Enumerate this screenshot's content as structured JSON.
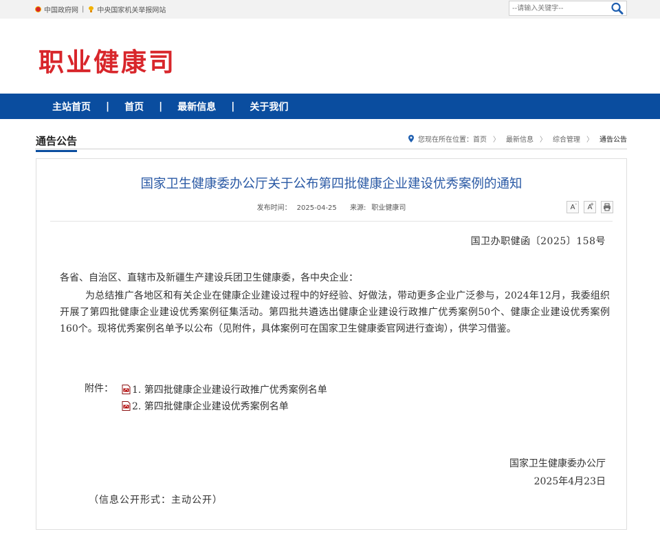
{
  "topbar": {
    "link1": "中国政府网",
    "separator": "|",
    "link2": "中央国家机关举报网站",
    "search_placeholder": "--请输入关键字--"
  },
  "header": {
    "site_title": "职业健康司"
  },
  "nav": {
    "items": [
      "主站首页",
      "首页",
      "最新信息",
      "关于我们"
    ],
    "separator": "|"
  },
  "section": {
    "title": "通告公告",
    "breadcrumb_prefix": "您现在所在位置：",
    "breadcrumb": [
      "首页",
      "最新信息",
      "综合管理",
      "通告公告"
    ],
    "breadcrumb_sep": "〉"
  },
  "article": {
    "title": "国家卫生健康委办公厅关于公布第四批健康企业建设优秀案例的通知",
    "publish_label": "发布时间：",
    "publish_date": "2025-04-25",
    "source_label": "来源:",
    "source": "职业健康司",
    "tools": {
      "font_smaller": "A",
      "font_smaller_sup": "-",
      "font_larger": "A",
      "font_larger_sup": "+",
      "print": "print"
    },
    "doc_number": "国卫办职健函〔2025〕158号",
    "salutation": "各省、自治区、直辖市及新疆生产建设兵团卫生健康委，各中央企业：",
    "paragraph": "为总结推广各地区和有关企业在健康企业建设过程中的好经验、好做法，带动更多企业广泛参与，2024年12月，我委组织开展了第四批健康企业建设优秀案例征集活动。第四批共遴选出健康企业建设行政推广优秀案例50个、健康企业建设优秀案例160个。现将优秀案例名单予以公布（见附件，具体案例可在国家卫生健康委官网进行查询），供学习借鉴。",
    "attachment_label": "附件：",
    "attachments": [
      "1. 第四批健康企业建设行政推广优秀案例名单",
      "2. 第四批健康企业建设优秀案例名单"
    ],
    "signature_org": "国家卫生健康委办公厅",
    "signature_date": "2025年4月23日",
    "disclosure": "（信息公开形式：主动公开）"
  },
  "colors": {
    "brand_red": "#d8262b",
    "nav_blue": "#0a4d9f",
    "title_blue": "#2b5aa5"
  }
}
